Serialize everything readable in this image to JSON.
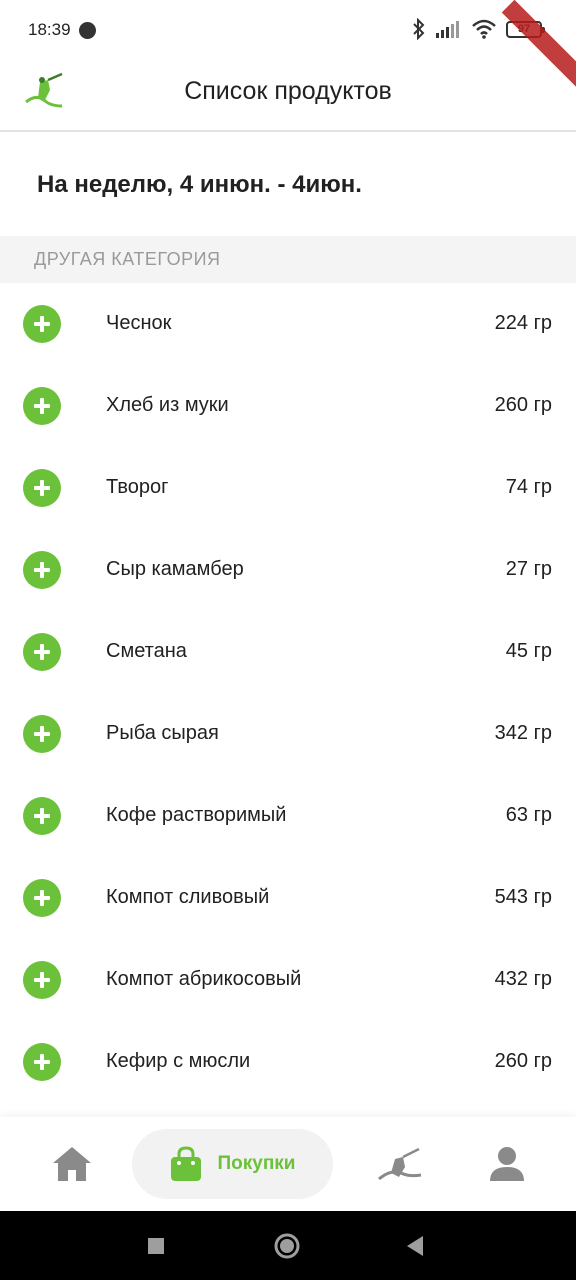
{
  "status_bar": {
    "time": "18:39",
    "battery": "97"
  },
  "app_bar": {
    "title": "Список продуктов"
  },
  "week": {
    "label": "На неделю, 4 инюн. - 4июн."
  },
  "category": {
    "title": "ДРУГАЯ КАТЕГОРИЯ"
  },
  "items": [
    {
      "name": "Чеснок",
      "amount": "224 гр"
    },
    {
      "name": "Хлеб из муки",
      "amount": "260 гр"
    },
    {
      "name": "Творог",
      "amount": "74 гр"
    },
    {
      "name": "Сыр камамбер",
      "amount": "27 гр"
    },
    {
      "name": "Сметана",
      "amount": "45 гр"
    },
    {
      "name": "Рыба сырая",
      "amount": "342 гр"
    },
    {
      "name": "Кофе растворимый",
      "amount": "63 гр"
    },
    {
      "name": "Компот сливовый",
      "amount": "543 гр"
    },
    {
      "name": "Компот абрикосовый",
      "amount": "432 гр"
    },
    {
      "name": "Кефир с мюсли",
      "amount": "260 гр"
    }
  ],
  "bottom_nav": {
    "shopping_label": "Покупки",
    "icons": [
      "home-icon",
      "shopping-bag-icon",
      "diary-icon",
      "profile-icon"
    ]
  },
  "colors": {
    "accent": "#6cc13a",
    "category_bg": "#f4f4f4",
    "muted_text": "#9a9a9a"
  }
}
